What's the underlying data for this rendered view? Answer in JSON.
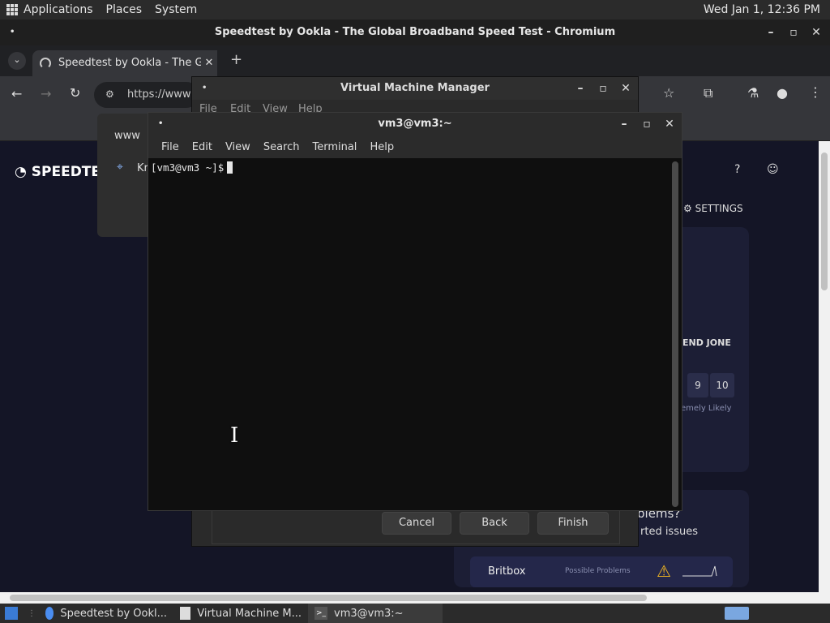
{
  "top_panel": {
    "applications": "Applications",
    "places": "Places",
    "system": "System",
    "clock": "Wed Jan 1, 12:36 PM"
  },
  "chromium": {
    "window_title": "Speedtest by Ookla - The Global Broadband Speed Test - Chromium",
    "tab_title": "Speedtest by Ookla - The Global Broadband Speed Test",
    "url": "https://www"
  },
  "speedtest": {
    "logo": "SPEEDTE",
    "settings": "SETTINGS",
    "recommend": "END JONE",
    "score_9": "9",
    "score_10": "10",
    "likely": "emely Likely",
    "problems": "blems?",
    "reported": "rted issues",
    "service": "Britbox",
    "possible_problems": "Possible Problems",
    "dialog_line1": "www",
    "dialog_line2": "Kr"
  },
  "vmm": {
    "title": "Virtual Machine Manager",
    "menu": [
      "File",
      "Edit",
      "View",
      "Help"
    ],
    "cancel": "Cancel",
    "back": "Back",
    "finish": "Finish"
  },
  "terminal": {
    "title": "vm3@vm3:~",
    "menu": [
      "File",
      "Edit",
      "View",
      "Search",
      "Terminal",
      "Help"
    ],
    "prompt": "[vm3@vm3 ~]$"
  },
  "taskbar": {
    "items": [
      "Speedtest by Ookl...",
      "Virtual Machine M...",
      "vm3@vm3:~"
    ]
  }
}
